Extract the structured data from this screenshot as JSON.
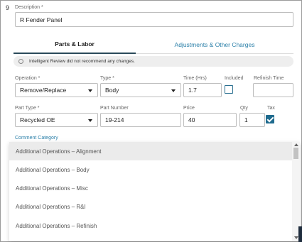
{
  "line_number": "9",
  "description": {
    "label": "Description *",
    "value": "R Fender Panel"
  },
  "tabs": [
    {
      "label": "Parts & Labor",
      "active": true
    },
    {
      "label": "Adjustments & Other Charges",
      "active": false
    }
  ],
  "banner": {
    "icon": "info-icon",
    "text": "Intelligent Review did not recommend any changes."
  },
  "row1": {
    "operation": {
      "label": "Operation *",
      "value": "Remove/Replace"
    },
    "type": {
      "label": "Type *",
      "value": "Body"
    },
    "time": {
      "label": "Time (Hrs)",
      "value": "1.7"
    },
    "included": {
      "label": "Included",
      "checked": false
    },
    "refinish_time": {
      "label": "Refinish Time",
      "value": ""
    }
  },
  "row2": {
    "part_type": {
      "label": "Part Type *",
      "value": "Recycled OE"
    },
    "part_number": {
      "label": "Part Number",
      "value": "19-214"
    },
    "price": {
      "label": "Price",
      "value": "40"
    },
    "qty": {
      "label": "Qty",
      "value": "1"
    },
    "tax": {
      "label": "Tax",
      "checked": true
    }
  },
  "comment_category": {
    "label": "Comment Category",
    "options": [
      "Additional Operations – Alignment",
      "Additional Operations – Body",
      "Additional Operations – Misc",
      "Additional Operations – R&I",
      "Additional Operations – Refinish"
    ],
    "highlighted_index": 0
  },
  "colors": {
    "accent": "#2a7fa8",
    "checkbox": "#1f6b8e",
    "tab_underline": "#2b4a5a"
  }
}
